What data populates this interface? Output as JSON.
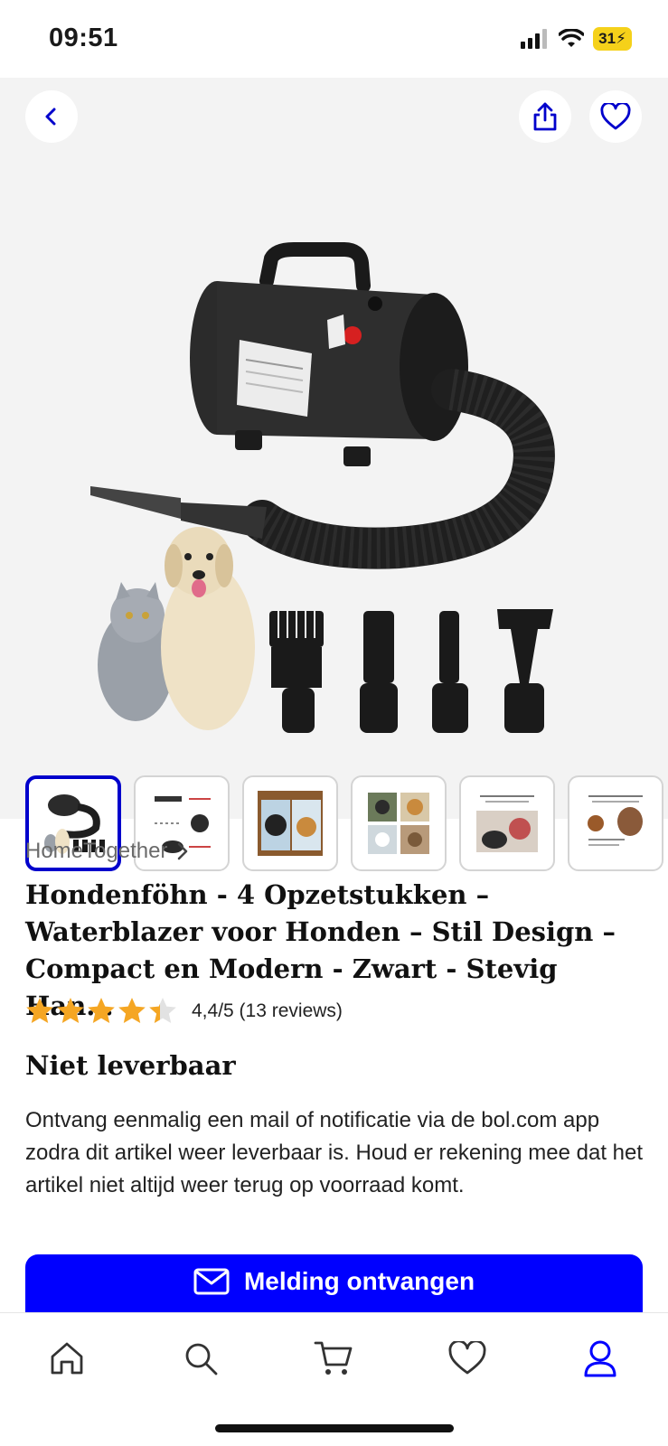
{
  "status_bar": {
    "time": "09:51",
    "battery": "31"
  },
  "seller": {
    "name": "HomeTogether"
  },
  "product": {
    "title": "Hondenföhn - 4 Opzetstukken – Waterblazer voor Honden – Stil Design – Compact en Modern - Zwart - Stevig Han...",
    "rating": 4.4,
    "rating_text": "4,4/5 (13 reviews)",
    "availability": "Niet leverbaar",
    "notice": "Ontvang eenmalig een mail of notificatie via de bol.com app zodra dit artikel weer leverbaar is. Houd er rekening mee dat het artikel niet altijd weer terug op voorraad komt."
  },
  "cta": {
    "label": "Melding ontvangen",
    "icon": "mail-icon"
  },
  "thumbnails": {
    "count": 6,
    "active_index": 0
  },
  "colors": {
    "accent": "#0000ff",
    "star": "#f5a623",
    "battery": "#f5d11a",
    "nav_active": "#0000ff"
  },
  "bottom_nav": [
    {
      "icon": "home-icon"
    },
    {
      "icon": "search-icon"
    },
    {
      "icon": "cart-icon"
    },
    {
      "icon": "heart-icon"
    },
    {
      "icon": "account-icon"
    }
  ]
}
